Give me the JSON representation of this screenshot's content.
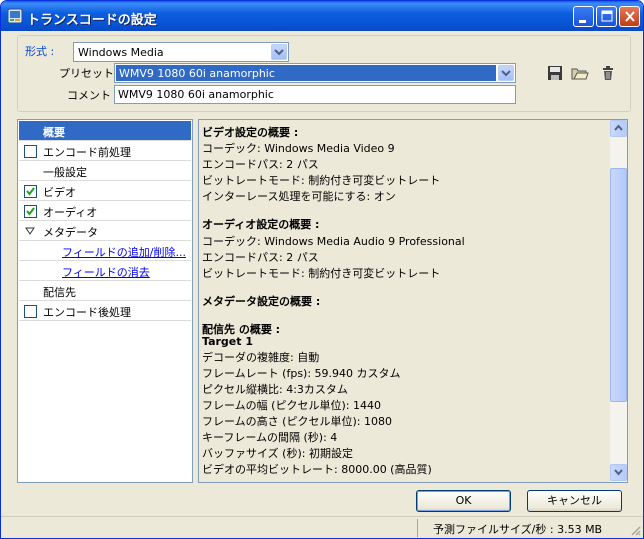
{
  "window": {
    "title": "トランスコードの設定"
  },
  "format": {
    "label": "形式 :",
    "value": "Windows Media"
  },
  "preset": {
    "label": "プリセット :",
    "value": "WMV9 1080 60i anamorphic"
  },
  "comment": {
    "label": "コメント :",
    "value": "WMV9 1080 60i anamorphic"
  },
  "left_panel": {
    "items": [
      {
        "label": "概要"
      },
      {
        "label": "エンコード前処理",
        "checked": false
      },
      {
        "label": "一般設定"
      },
      {
        "label": "ビデオ",
        "checked": true
      },
      {
        "label": "オーディオ",
        "checked": true
      },
      {
        "label": "メタデータ"
      },
      {
        "label": "フィールドの追加/削除..."
      },
      {
        "label": "フィールドの消去"
      },
      {
        "label": "配信先"
      },
      {
        "label": "エンコード後処理",
        "checked": false
      }
    ]
  },
  "summary": {
    "lines": [
      {
        "text": "ビデオ設定の概要 :",
        "bold": true
      },
      {
        "text": "コーデック: Windows Media Video 9"
      },
      {
        "text": "エンコードパス: 2 パス"
      },
      {
        "text": "ビットレートモード: 制約付き可変ビットレート"
      },
      {
        "text": "インターレース処理を可能にする: オン"
      },
      {
        "text": "オーディオ設定の概要 :",
        "bold": true
      },
      {
        "text": "コーデック: Windows Media Audio 9 Professional"
      },
      {
        "text": "エンコードパス: 2 パス"
      },
      {
        "text": "ビットレートモード: 制約付き可変ビットレート"
      },
      {
        "text": "メタデータ設定の概要 :",
        "bold": true
      },
      {
        "text": "配信先 の概要 :",
        "bold": true
      },
      {
        "text": "Target 1",
        "bold": true
      },
      {
        "text": "デコーダの複雑度: 自動"
      },
      {
        "text": "フレームレート (fps): 59.940 カスタム"
      },
      {
        "text": "ピクセル縦横比: 4:3カスタム"
      },
      {
        "text": "フレームの幅 (ピクセル単位): 1440"
      },
      {
        "text": "フレームの高さ (ピクセル単位): 1080"
      },
      {
        "text": "キーフレームの間隔 (秒): 4"
      },
      {
        "text": "バッファサイズ (秒): 初期設定"
      },
      {
        "text": "ビデオの平均ビットレート: 8000.00 (高品質)"
      }
    ]
  },
  "buttons": {
    "ok": "OK",
    "cancel": "キャンセル"
  },
  "status": {
    "text": "予測ファイルサイズ/秒 : 3.53 MB"
  }
}
